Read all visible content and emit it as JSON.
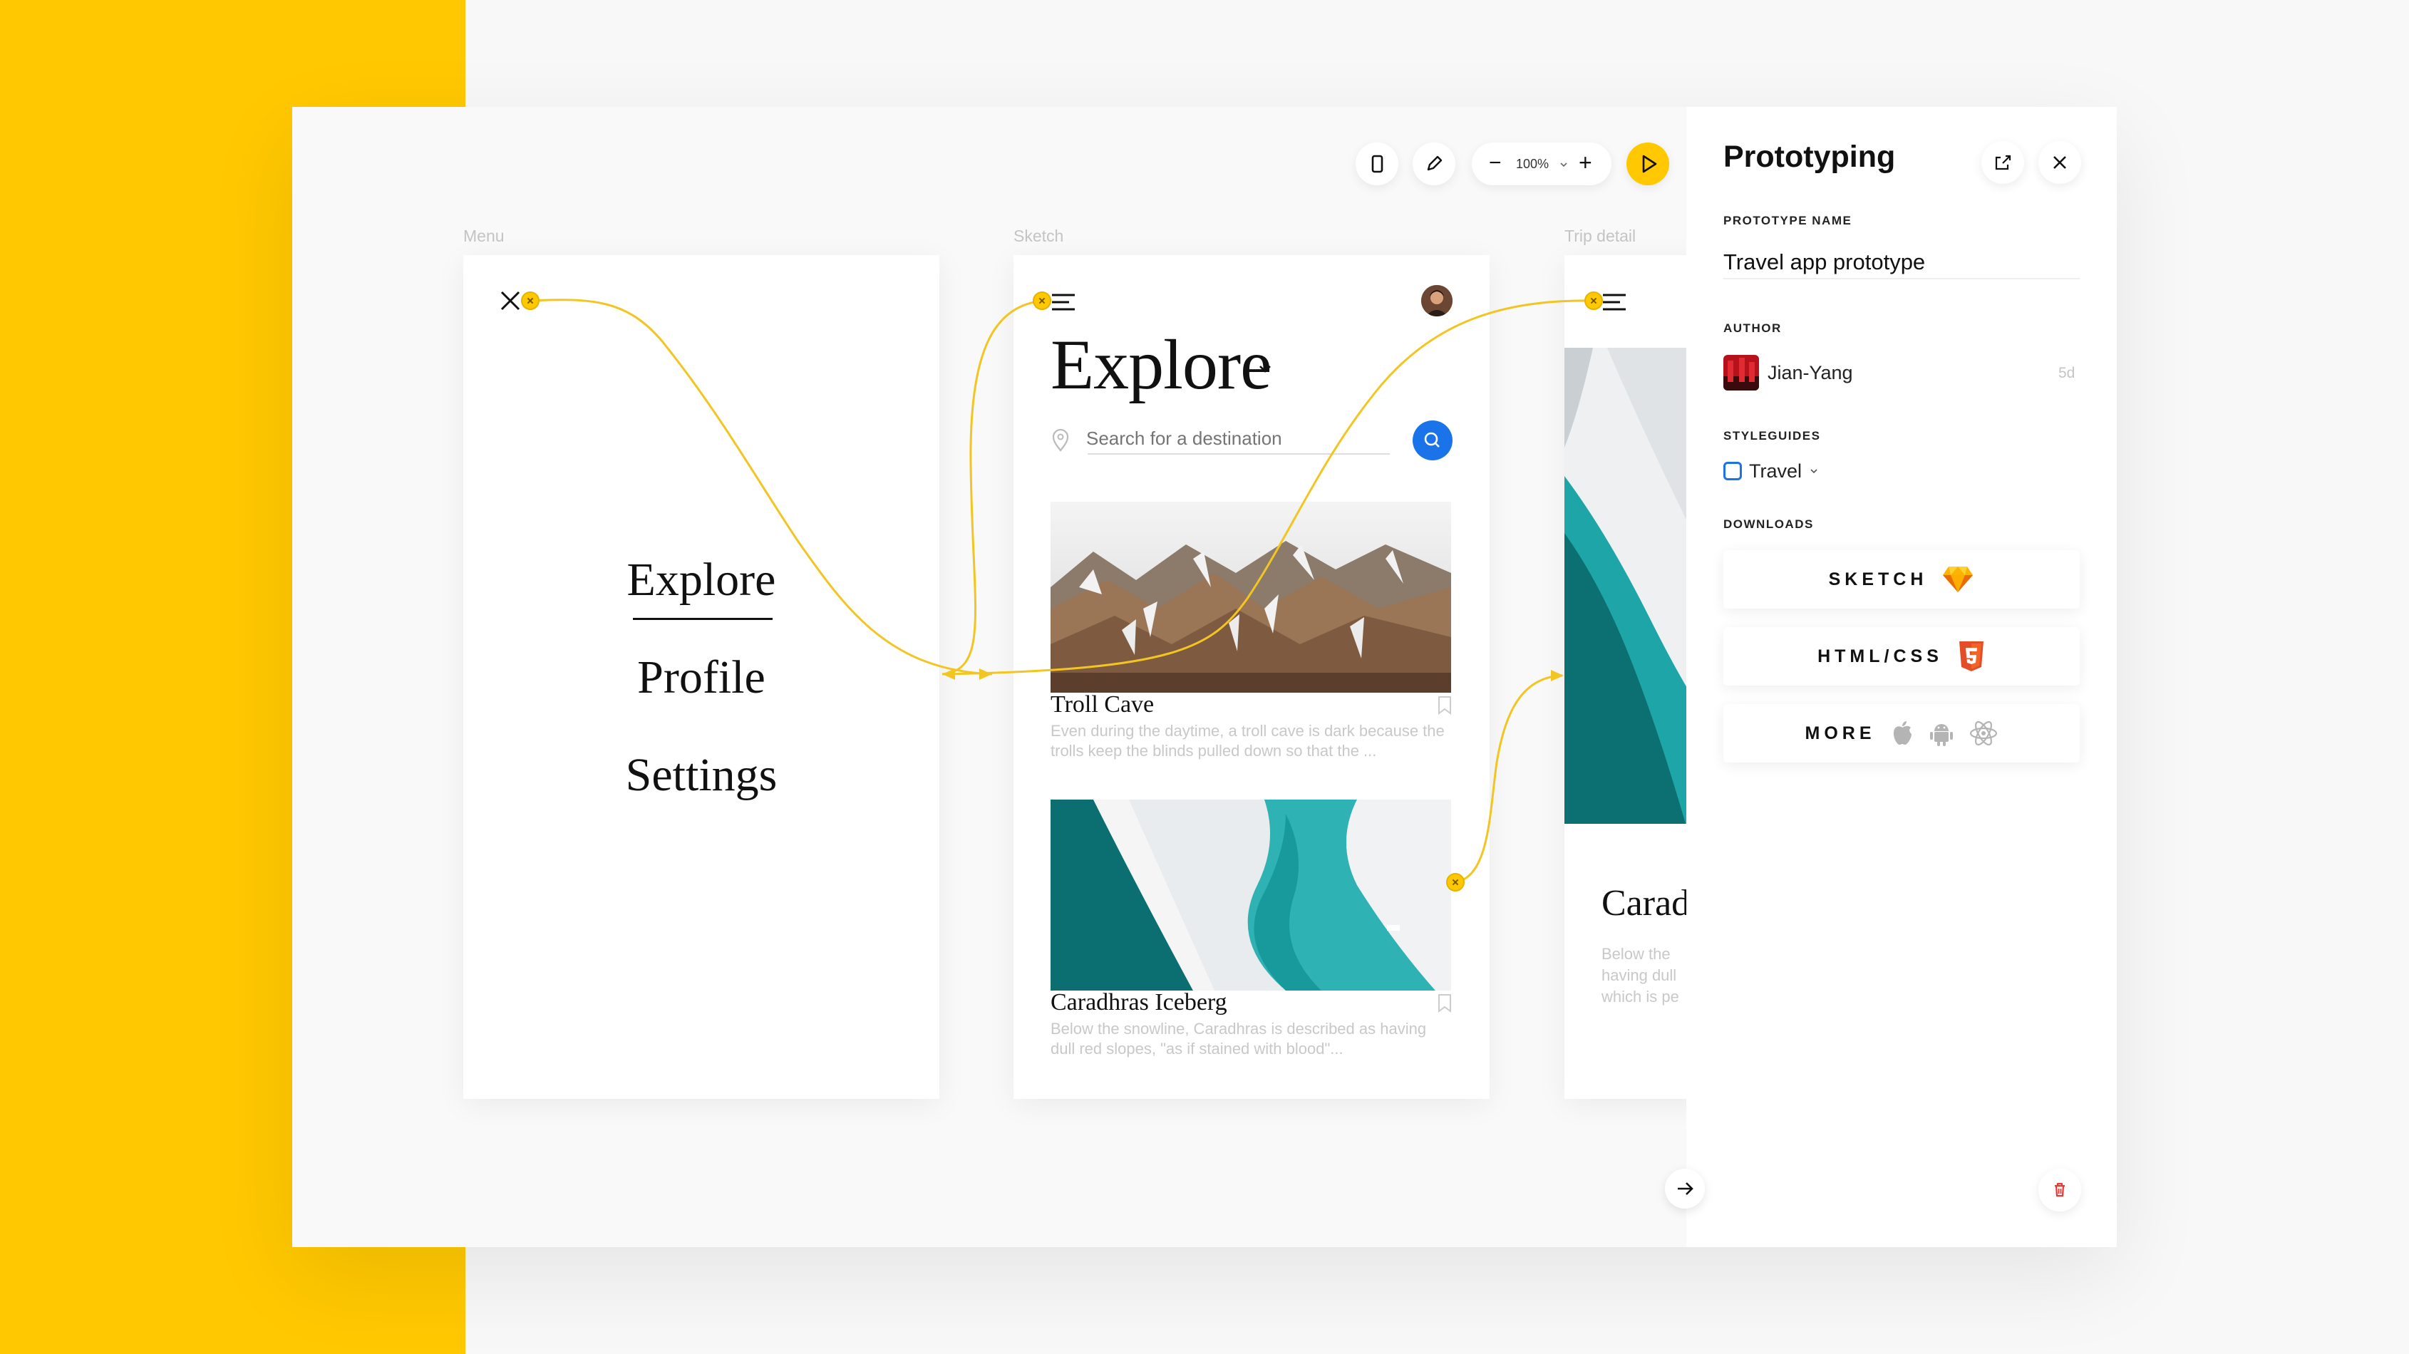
{
  "toolbar": {
    "zoom_label": "100%",
    "zoom_minus": "−",
    "zoom_plus": "+"
  },
  "frames": {
    "menu": {
      "label": "Menu",
      "items": [
        "Explore",
        "Profile",
        "Settings"
      ]
    },
    "sketch": {
      "label": "Sketch",
      "title": "Explore",
      "search_placeholder": "Search for a destination",
      "cards": [
        {
          "title": "Troll Cave",
          "description": "Even during the daytime, a troll cave is dark because the trolls keep the blinds pulled down so that the ..."
        },
        {
          "title": "Caradhras Iceberg",
          "description": "Below the snowline, Caradhras is described as having dull red slopes, \"as if stained with blood\"..."
        }
      ]
    },
    "trip_detail": {
      "label": "Trip detail",
      "title_partial": "Carad",
      "desc_partial": [
        "Below the",
        "having dull",
        "which is pe"
      ]
    }
  },
  "panel": {
    "title": "Prototyping",
    "prototype_name_label": "PROTOTYPE NAME",
    "prototype_name_value": "Travel app prototype",
    "author_label": "AUTHOR",
    "author_name": "Jian-Yang",
    "author_time": "5d",
    "styleguides_label": "STYLEGUIDES",
    "styleguide_value": "Travel",
    "downloads_label": "DOWNLOADS",
    "downloads": [
      {
        "label": "SKETCH",
        "icon": "sketch-diamond-icon"
      },
      {
        "label": "HTML/CSS",
        "icon": "html5-icon"
      },
      {
        "label": "MORE",
        "icons": [
          "apple-icon",
          "android-icon",
          "react-icon"
        ]
      }
    ]
  },
  "colors": {
    "accent_yellow": "#ffc800",
    "link_line": "#f2c522",
    "search_blue": "#1a73e8",
    "styleguide_blue": "#1a73e8",
    "html5_orange": "#e44d26",
    "delete_red": "#e53935"
  }
}
